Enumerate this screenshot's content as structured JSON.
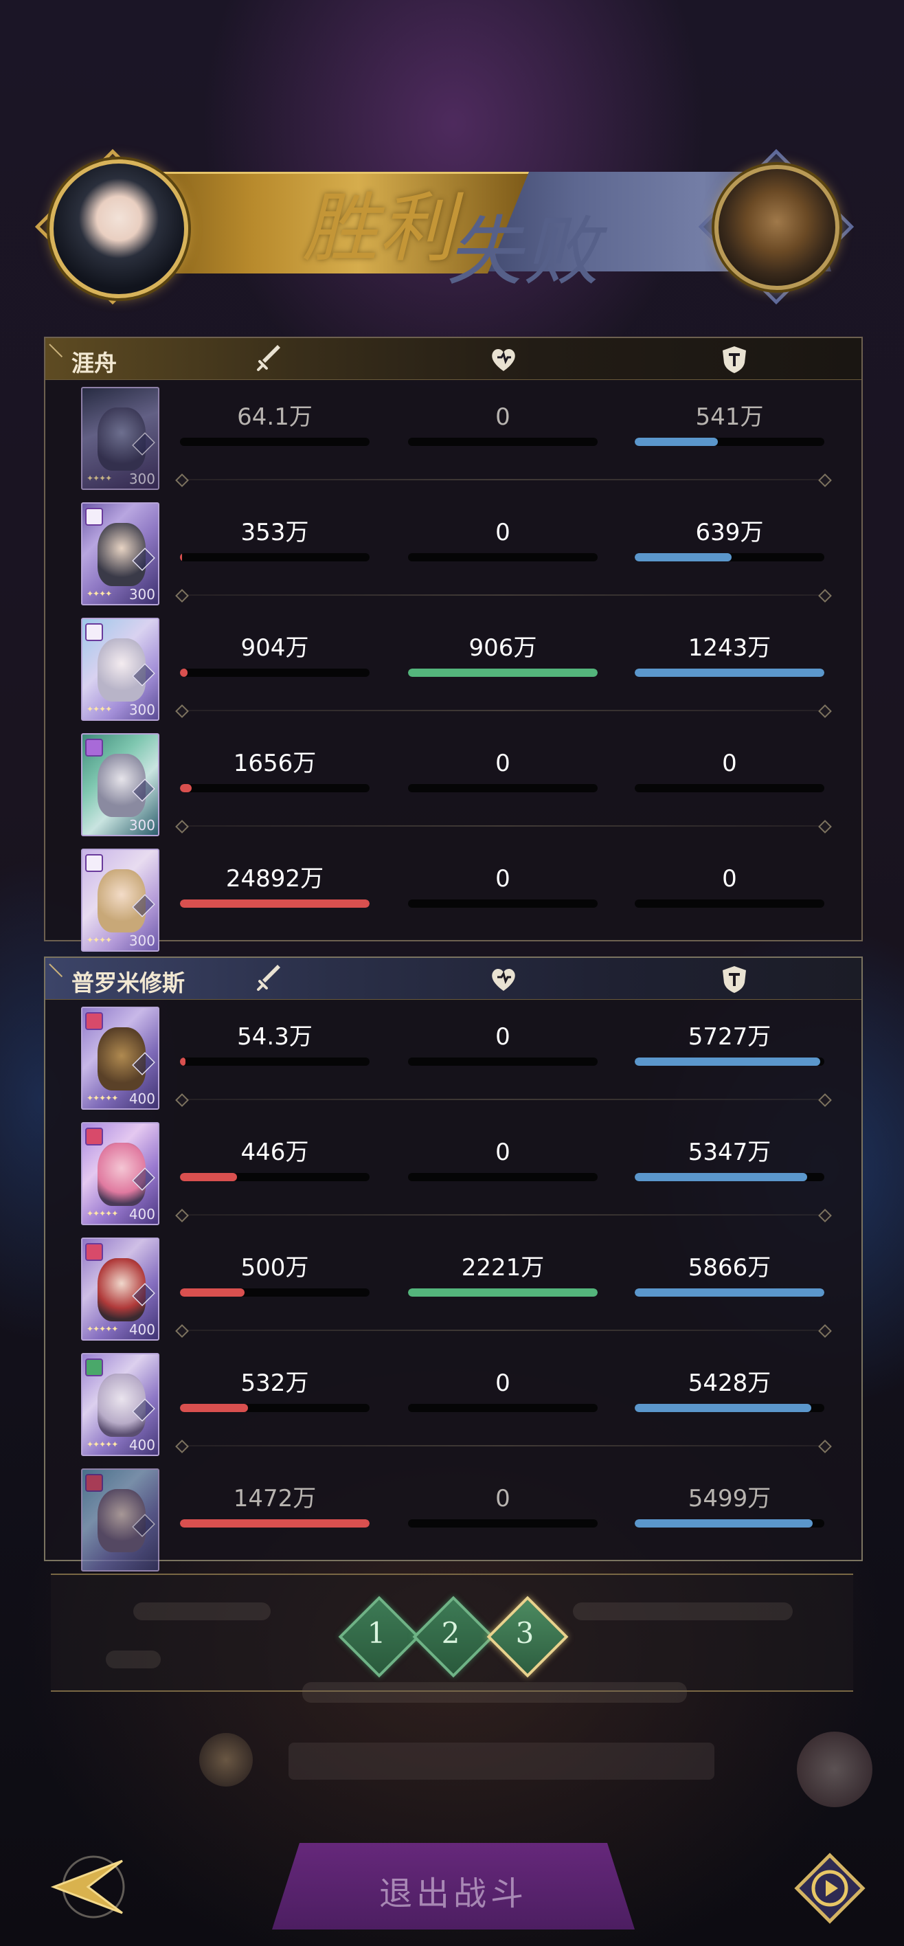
{
  "banner": {
    "win_text": "胜利",
    "lose_text": "失败"
  },
  "teams": [
    {
      "name": "涯舟",
      "rows": [
        {
          "damage": "64.1万",
          "damage_fill": 0.0,
          "heal": "0",
          "heal_fill": 0,
          "shield": "541万",
          "shield_fill": 0.44,
          "level": "300",
          "dim": true
        },
        {
          "damage": "353万",
          "damage_fill": 0.01,
          "heal": "0",
          "heal_fill": 0,
          "shield": "639万",
          "shield_fill": 0.51,
          "level": "300",
          "dim": false
        },
        {
          "damage": "904万",
          "damage_fill": 0.04,
          "heal": "906万",
          "heal_fill": 1.0,
          "shield": "1243万",
          "shield_fill": 1.0,
          "level": "300",
          "dim": false
        },
        {
          "damage": "1656万",
          "damage_fill": 0.06,
          "heal": "0",
          "heal_fill": 0,
          "shield": "0",
          "shield_fill": 0,
          "level": "300",
          "dim": false
        },
        {
          "damage": "24892万",
          "damage_fill": 1.0,
          "heal": "0",
          "heal_fill": 0,
          "shield": "0",
          "shield_fill": 0,
          "level": "300",
          "dim": false
        }
      ]
    },
    {
      "name": "普罗米修斯",
      "rows": [
        {
          "damage": "54.3万",
          "damage_fill": 0.03,
          "heal": "0",
          "heal_fill": 0,
          "shield": "5727万",
          "shield_fill": 0.98,
          "level": "400",
          "dim": false
        },
        {
          "damage": "446万",
          "damage_fill": 0.3,
          "heal": "0",
          "heal_fill": 0,
          "shield": "5347万",
          "shield_fill": 0.91,
          "level": "400",
          "dim": false
        },
        {
          "damage": "500万",
          "damage_fill": 0.34,
          "heal": "2221万",
          "heal_fill": 1.0,
          "shield": "5866万",
          "shield_fill": 1.0,
          "level": "400",
          "dim": false
        },
        {
          "damage": "532万",
          "damage_fill": 0.36,
          "heal": "0",
          "heal_fill": 0,
          "shield": "5428万",
          "shield_fill": 0.93,
          "level": "400",
          "dim": false
        },
        {
          "damage": "1472万",
          "damage_fill": 1.0,
          "heal": "0",
          "heal_fill": 0,
          "shield": "5499万",
          "shield_fill": 0.94,
          "level": "",
          "dim": true
        }
      ]
    }
  ],
  "pager": {
    "pages": [
      "1",
      "2",
      "3"
    ],
    "active": 2
  },
  "footer": {
    "exit_label": "退出战斗"
  },
  "icons": {
    "damage": "sword-icon",
    "heal": "heart-icon",
    "shield": "shield-icon",
    "back": "back-arrow-icon",
    "replay": "replay-icon"
  },
  "colors": {
    "damage": "#d9504f",
    "heal": "#54b57c",
    "shield": "#5b97cc",
    "gold": "#c49637"
  }
}
